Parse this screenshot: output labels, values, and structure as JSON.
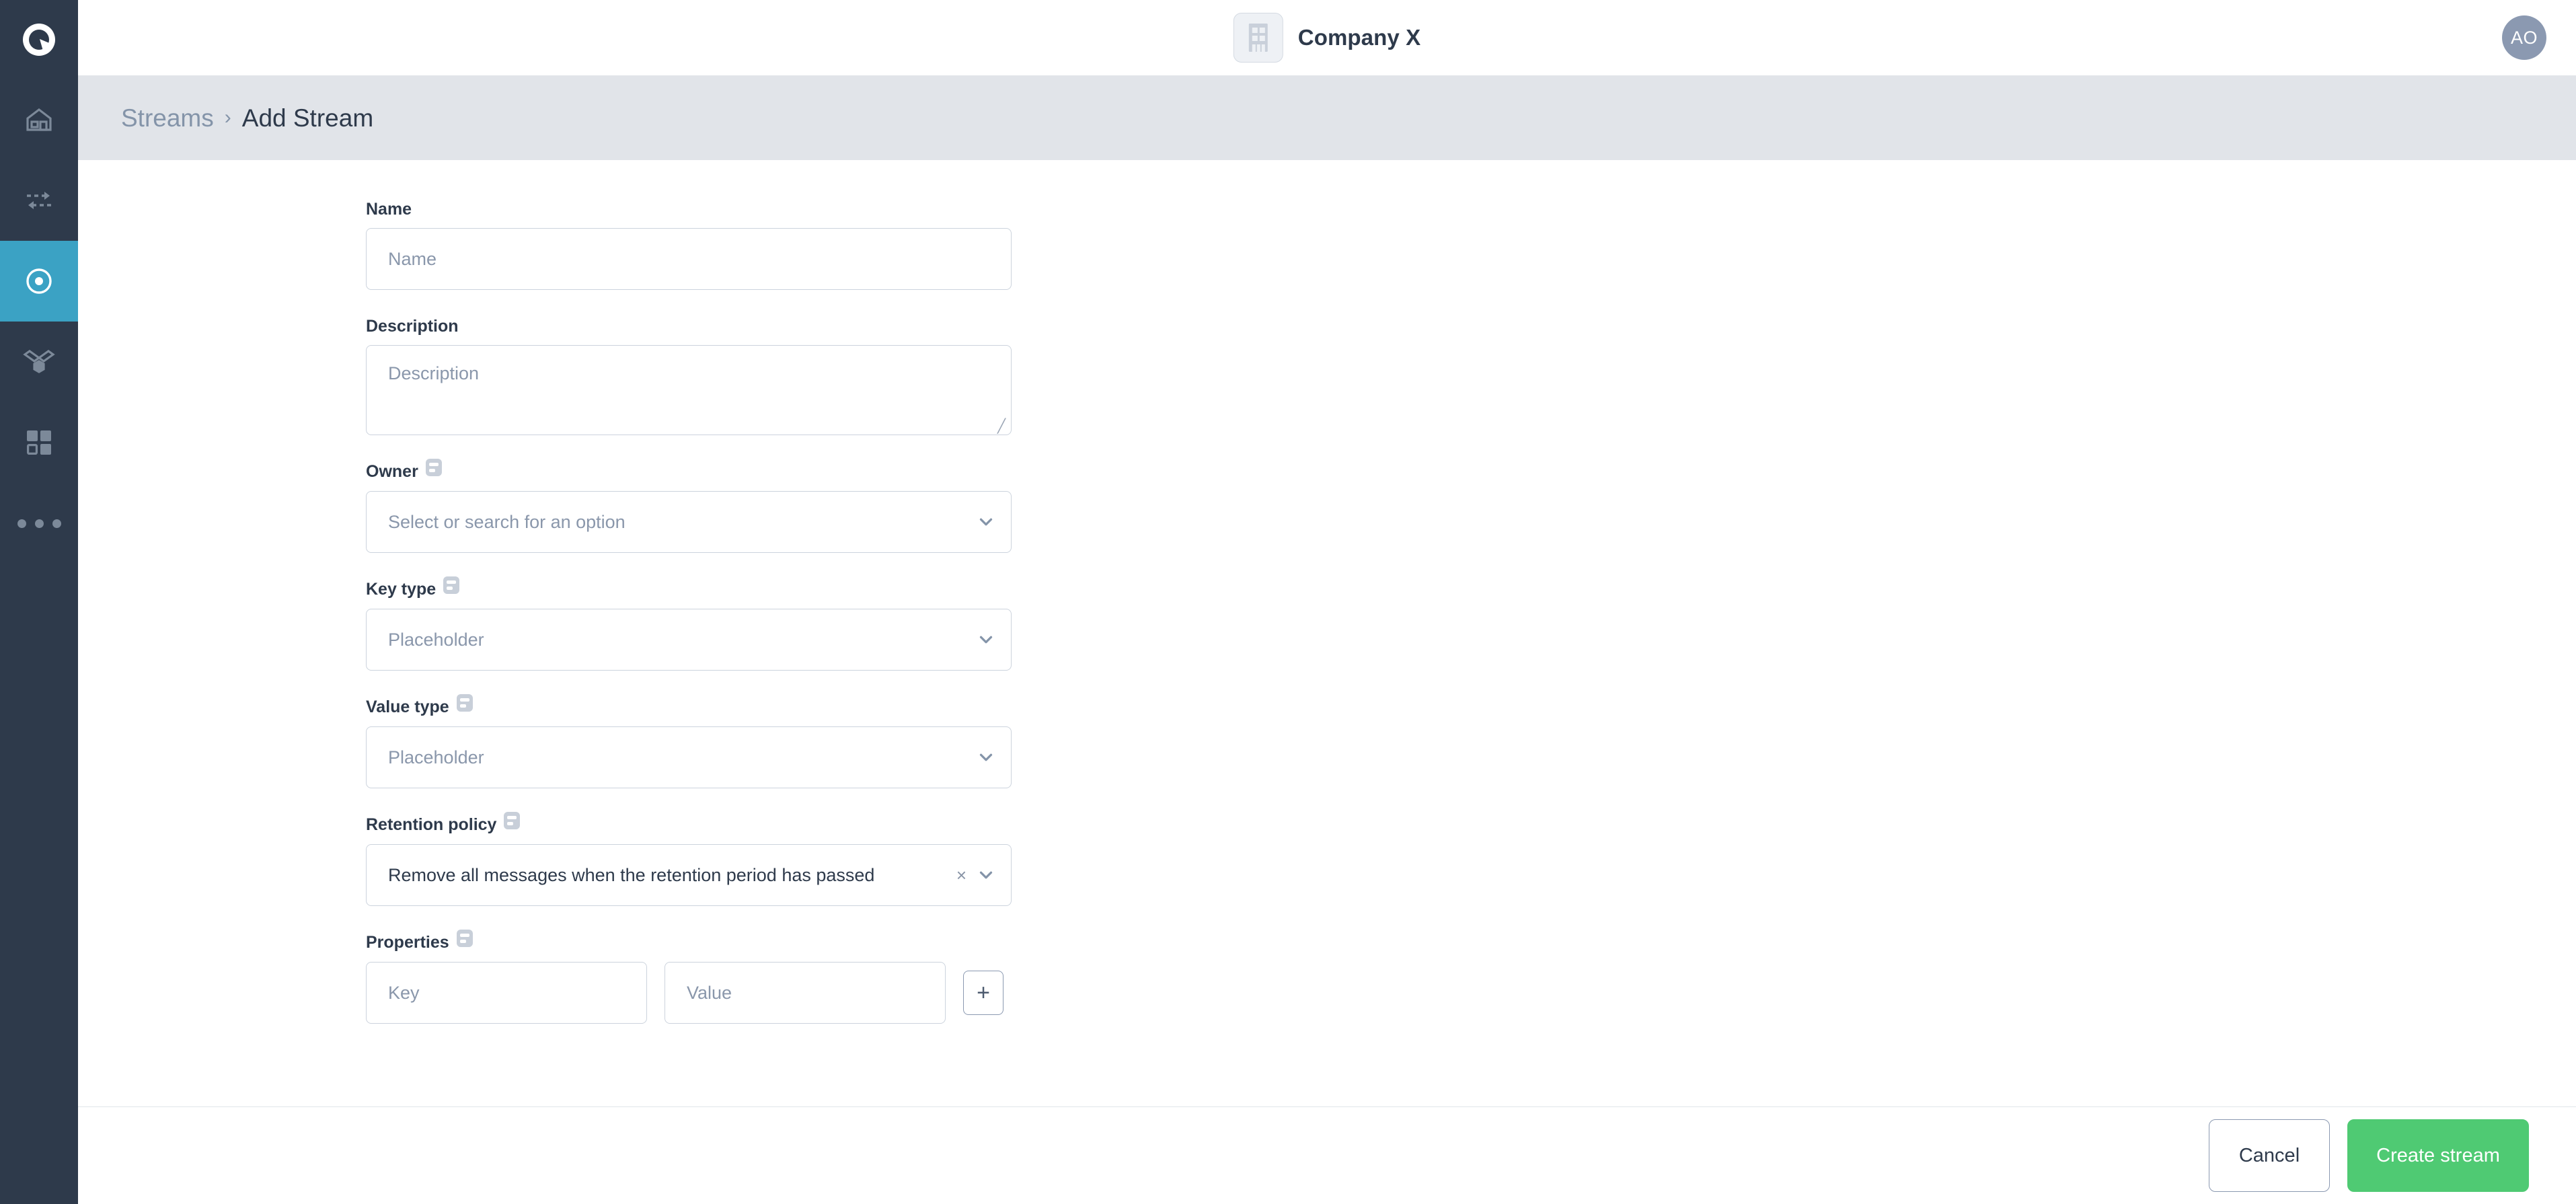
{
  "sidebar": {
    "logo_icon": "q-logo-icon",
    "items": [
      {
        "name": "home",
        "icon": "home-icon",
        "active": false
      },
      {
        "name": "transfer",
        "icon": "bidirectional-arrows-icon",
        "active": false
      },
      {
        "name": "streams",
        "icon": "record-circle-icon",
        "active": true
      },
      {
        "name": "topology",
        "icon": "nodes-hexagon-icon",
        "active": false
      },
      {
        "name": "apps",
        "icon": "grid-squares-icon",
        "active": false
      },
      {
        "name": "more",
        "icon": "more-dots-icon",
        "active": false
      }
    ]
  },
  "header": {
    "company_icon": "building-icon",
    "company_name": "Company X",
    "avatar_initials": "AO"
  },
  "breadcrumb": {
    "parent": "Streams",
    "separator": "›",
    "current": "Add Stream"
  },
  "form": {
    "name": {
      "label": "Name",
      "value": "",
      "placeholder": "Name"
    },
    "description": {
      "label": "Description",
      "value": "",
      "placeholder": "Description"
    },
    "owner": {
      "label": "Owner",
      "help_icon": "tooltip-icon",
      "value": "",
      "placeholder": "Select or search for an option",
      "chevron": "chevron-down-icon"
    },
    "key_type": {
      "label": "Key type",
      "help_icon": "tooltip-icon",
      "value": "",
      "placeholder": "Placeholder",
      "chevron": "chevron-down-icon"
    },
    "value_type": {
      "label": "Value type",
      "help_icon": "tooltip-icon",
      "value": "",
      "placeholder": "Placeholder",
      "chevron": "chevron-down-icon"
    },
    "retention_policy": {
      "label": "Retention policy",
      "help_icon": "tooltip-icon",
      "value": "Remove all messages when the retention period has passed",
      "clear": "×",
      "chevron": "chevron-down-icon"
    },
    "properties": {
      "label": "Properties",
      "help_icon": "tooltip-icon",
      "key_value": "",
      "key_placeholder": "Key",
      "value_value": "",
      "value_placeholder": "Value",
      "add_label": "+"
    }
  },
  "footer": {
    "cancel_label": "Cancel",
    "create_label": "Create stream"
  },
  "colors": {
    "sidebar_bg": "#2e3a4b",
    "sidebar_active": "#3ba2c4",
    "breadcrumb_bg": "#e1e4e9",
    "primary_green": "#4fca73",
    "text_dark": "#2e3a4b",
    "text_muted": "#8a97ab",
    "border": "#ccd3dd"
  }
}
